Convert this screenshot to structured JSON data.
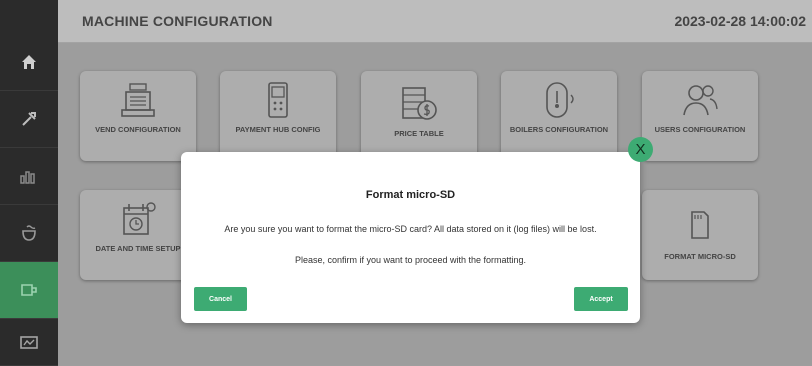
{
  "header": {
    "title": "MACHINE CONFIGURATION",
    "datetime": "2023-02-28 14:00:02"
  },
  "sidebar": {
    "items": [
      {
        "icon": "home-icon"
      },
      {
        "icon": "tools-icon"
      },
      {
        "icon": "statistics-icon"
      },
      {
        "icon": "cleaning-icon"
      },
      {
        "icon": "configuration-icon",
        "active": true
      },
      {
        "icon": "machine-icon"
      }
    ]
  },
  "cards": [
    {
      "label": "VEND CONFIGURATION",
      "icon": "cash-register-icon"
    },
    {
      "label": "PAYMENT HUB CONFIG",
      "icon": "payment-terminal-icon"
    },
    {
      "label": "PRICE TABLE",
      "icon": "price-table-icon"
    },
    {
      "label": "BOILERS CONFIGURATION",
      "icon": "boiler-icon"
    },
    {
      "label": "USERS CONFIGURATION",
      "icon": "users-icon"
    },
    {
      "label": "DATE AND TIME SETUP",
      "icon": "calendar-clock-icon"
    },
    {
      "label": "FORMAT MICRO-SD",
      "icon": "micro-sd-icon"
    }
  ],
  "modal": {
    "title": "Format micro-SD",
    "message": "Are you sure you want to format the micro-SD card? All data stored on it (log files) will be lost.",
    "confirm": "Please, confirm if you want to proceed with the formatting.",
    "cancel_label": "Cancel",
    "accept_label": "Accept",
    "close_label": "X"
  },
  "colors": {
    "accent": "#3dab73",
    "sidebar": "#2b2b2b",
    "header": "#bdbdbd"
  }
}
